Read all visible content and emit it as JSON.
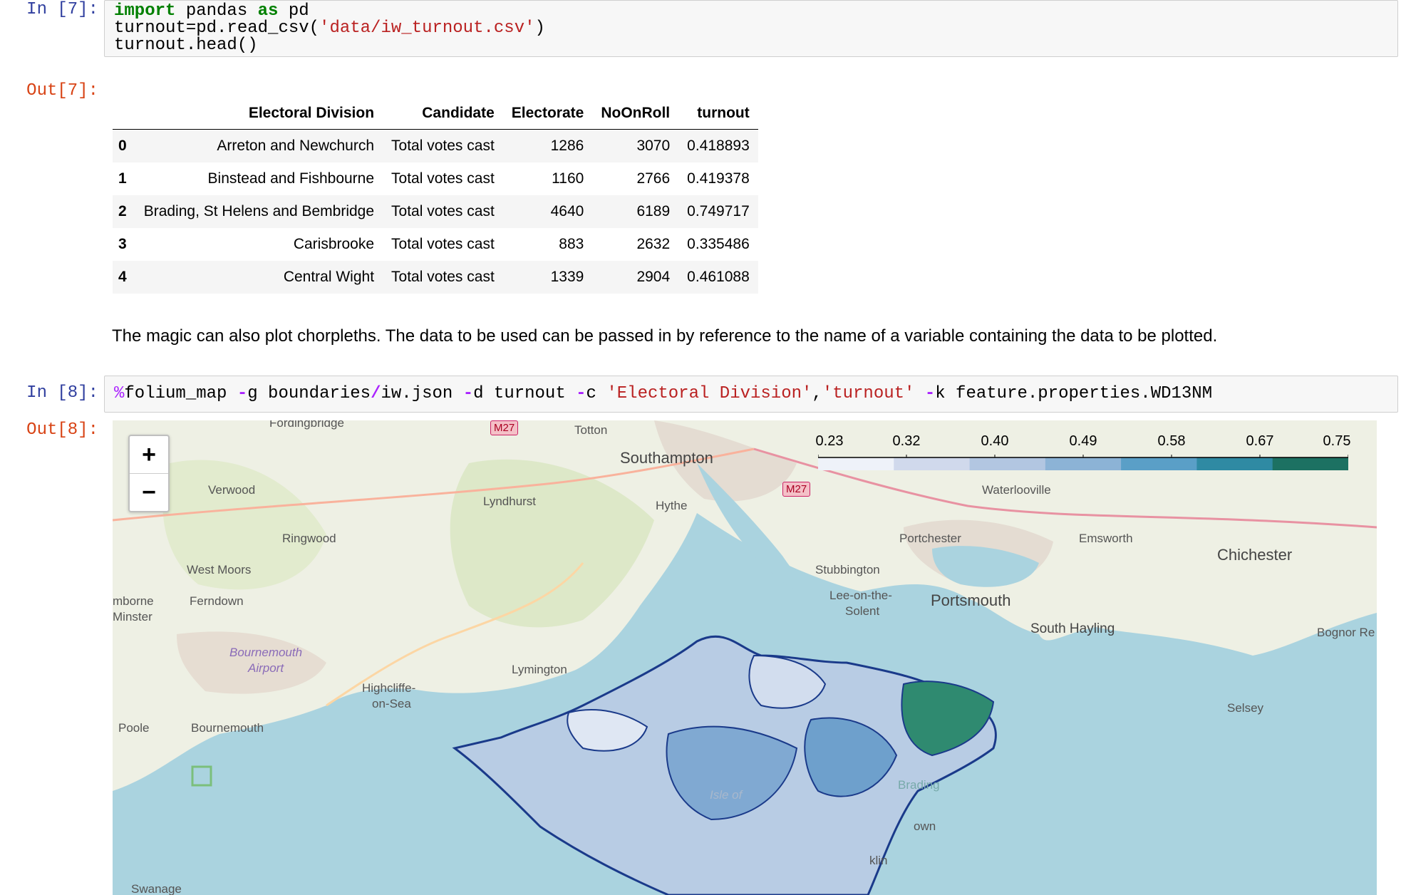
{
  "cells": {
    "cell7": {
      "in_prompt": "In [7]:",
      "out_prompt": "Out[7]:",
      "code": {
        "l1_kw1": "import",
        "l1_mid": " pandas ",
        "l1_kw2": "as",
        "l1_end": " pd",
        "l2_a": "turnout=pd.read_csv(",
        "l2_str": "'data/iw_turnout.csv'",
        "l2_b": ")",
        "l3": "turnout.head()"
      }
    },
    "cell8": {
      "in_prompt": "In [8]:",
      "out_prompt": "Out[8]:",
      "code": {
        "pct": "%",
        "t1": "folium_map ",
        "f1": "-",
        "t2": "g boundaries",
        "slash": "/",
        "t3": "iw.json ",
        "f2": "-",
        "t4": "d turnout ",
        "f3": "-",
        "t5": "c ",
        "s1": "'Electoral Division'",
        "comma": ",",
        "s2": "'turnout'",
        "sp": " ",
        "f4": "-",
        "t6": "k feature.properties.WD13NM"
      }
    }
  },
  "dataframe": {
    "columns": [
      "",
      "Electoral Division",
      "Candidate",
      "Electorate",
      "NoOnRoll",
      "turnout"
    ],
    "rows": [
      [
        "0",
        "Arreton and Newchurch",
        "Total votes cast",
        "1286",
        "3070",
        "0.418893"
      ],
      [
        "1",
        "Binstead and Fishbourne",
        "Total votes cast",
        "1160",
        "2766",
        "0.419378"
      ],
      [
        "2",
        "Brading, St Helens and Bembridge",
        "Total votes cast",
        "4640",
        "6189",
        "0.749717"
      ],
      [
        "3",
        "Carisbrooke",
        "Total votes cast",
        "883",
        "2632",
        "0.335486"
      ],
      [
        "4",
        "Central Wight",
        "Total votes cast",
        "1339",
        "2904",
        "0.461088"
      ]
    ]
  },
  "markdown": "The magic can also plot chorpleths. The data to be used can be passed in by reference to the name of a variable containing the data to be plotted.",
  "map": {
    "zoom_in": "+",
    "zoom_out": "−",
    "legend_ticks": [
      "0.23",
      "0.32",
      "0.40",
      "0.49",
      "0.58",
      "0.67",
      "0.75"
    ],
    "legend_colors": [
      "#eef2f9",
      "#d0d9ec",
      "#b2c6e1",
      "#8cb3d6",
      "#5a9fc7",
      "#2f8aa3",
      "#1c7162"
    ],
    "labels": {
      "southampton": "Southampton",
      "portsmouth": "Portsmouth",
      "chichester": "Chichester",
      "verwood": "Verwood",
      "ringwood": "Ringwood",
      "west_moors": "West Moors",
      "ferndown": "Ferndown",
      "wimborne": "mborne",
      "minster": "Minster",
      "bournemouth_airport1": "Bournemouth",
      "bournemouth_airport2": "Airport",
      "lyndhurst": "Lyndhurst",
      "hythe": "Hythe",
      "totton": "Totton",
      "waterlooville": "Waterlooville",
      "portchester": "Portchester",
      "emsworth": "Emsworth",
      "stubbington": "Stubbington",
      "lee1": "Lee-on-the-",
      "lee2": "Solent",
      "south_hayling": "South Hayling",
      "bognor": "Bognor Re",
      "lymington": "Lymington",
      "highcliffe1": "Highcliffe-",
      "highcliffe2": "on-Sea",
      "poole": "Poole",
      "bournemouth": "Bournemouth",
      "selsey": "Selsey",
      "swanage": "Swanage",
      "fordingbridge": "Fordingbridge",
      "brading": "Brading",
      "town": "own",
      "klin": "klin",
      "isle": "Isle of",
      "m27a": "M27",
      "m27b": "M27"
    }
  }
}
